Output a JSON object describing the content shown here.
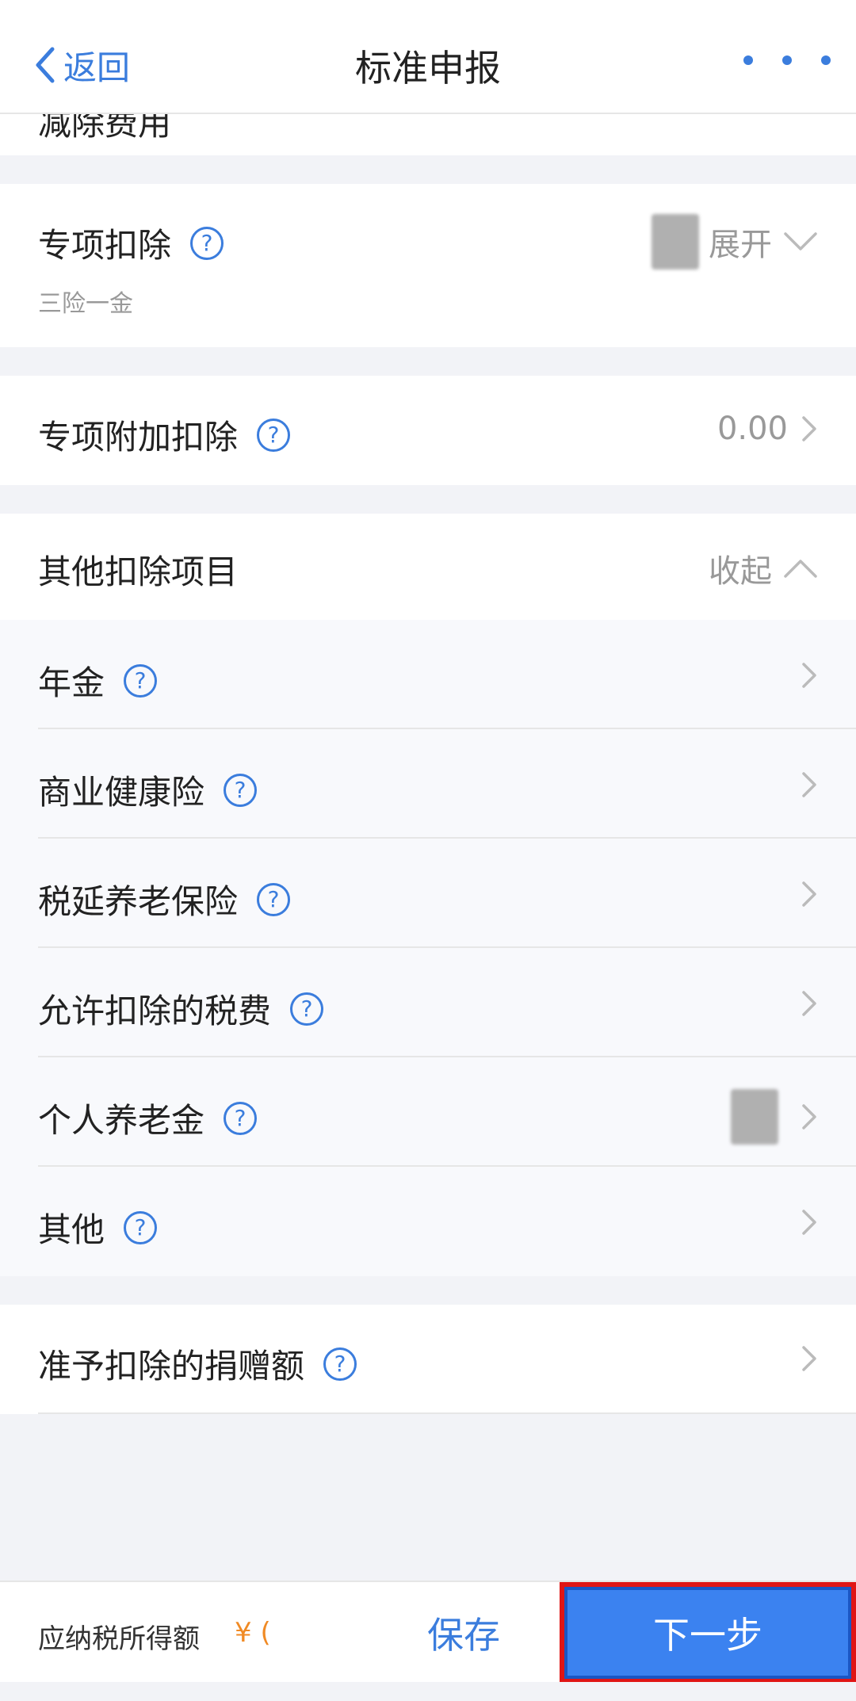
{
  "nav": {
    "back_label": "返回",
    "title": "标准申报"
  },
  "peek_row": {
    "label": "减除费用"
  },
  "special_deduction": {
    "label": "专项扣除",
    "sub_label": "三险一金",
    "toggle": "展开"
  },
  "special_additional": {
    "label": "专项附加扣除",
    "value": "0.00"
  },
  "other_deductions": {
    "label": "其他扣除项目",
    "toggle": "收起",
    "items": [
      {
        "label": "年金"
      },
      {
        "label": "商业健康险"
      },
      {
        "label": "税延养老保险"
      },
      {
        "label": "允许扣除的税费"
      },
      {
        "label": "个人养老金"
      },
      {
        "label": "其他"
      }
    ]
  },
  "donation": {
    "label": "准予扣除的捐赠额"
  },
  "footer": {
    "taxable_label": "应纳税所得额",
    "taxable_amount": "¥ (",
    "save_label": "保存",
    "next_label": "下一步"
  },
  "colors": {
    "accent": "#3b7ddd",
    "primary_button": "#3b82f0",
    "highlight_border": "#e01515",
    "amount": "#f08a24"
  }
}
